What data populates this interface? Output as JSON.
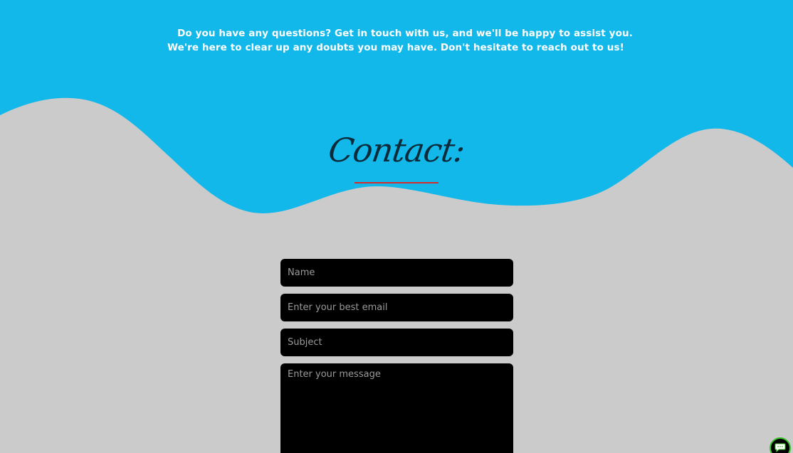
{
  "intro": {
    "line1": "Do you have any questions? Get in touch with us, and we'll be happy to assist you.",
    "line2": "We're here to clear up any doubts you may have. Don't hesitate to reach out to us!"
  },
  "contact": {
    "title": "Contact:"
  },
  "form": {
    "name_placeholder": "Name",
    "email_placeholder": "Enter your best email",
    "subject_placeholder": "Subject",
    "message_placeholder": "Enter your message"
  },
  "chat": {
    "icon": "chat-bubble-icon"
  },
  "colors": {
    "header_blue": "#12b8e9",
    "background_gray": "#cbcbcb",
    "field_black": "#000000",
    "underline_red": "#d62b2b",
    "chat_green": "#3ec22e"
  }
}
